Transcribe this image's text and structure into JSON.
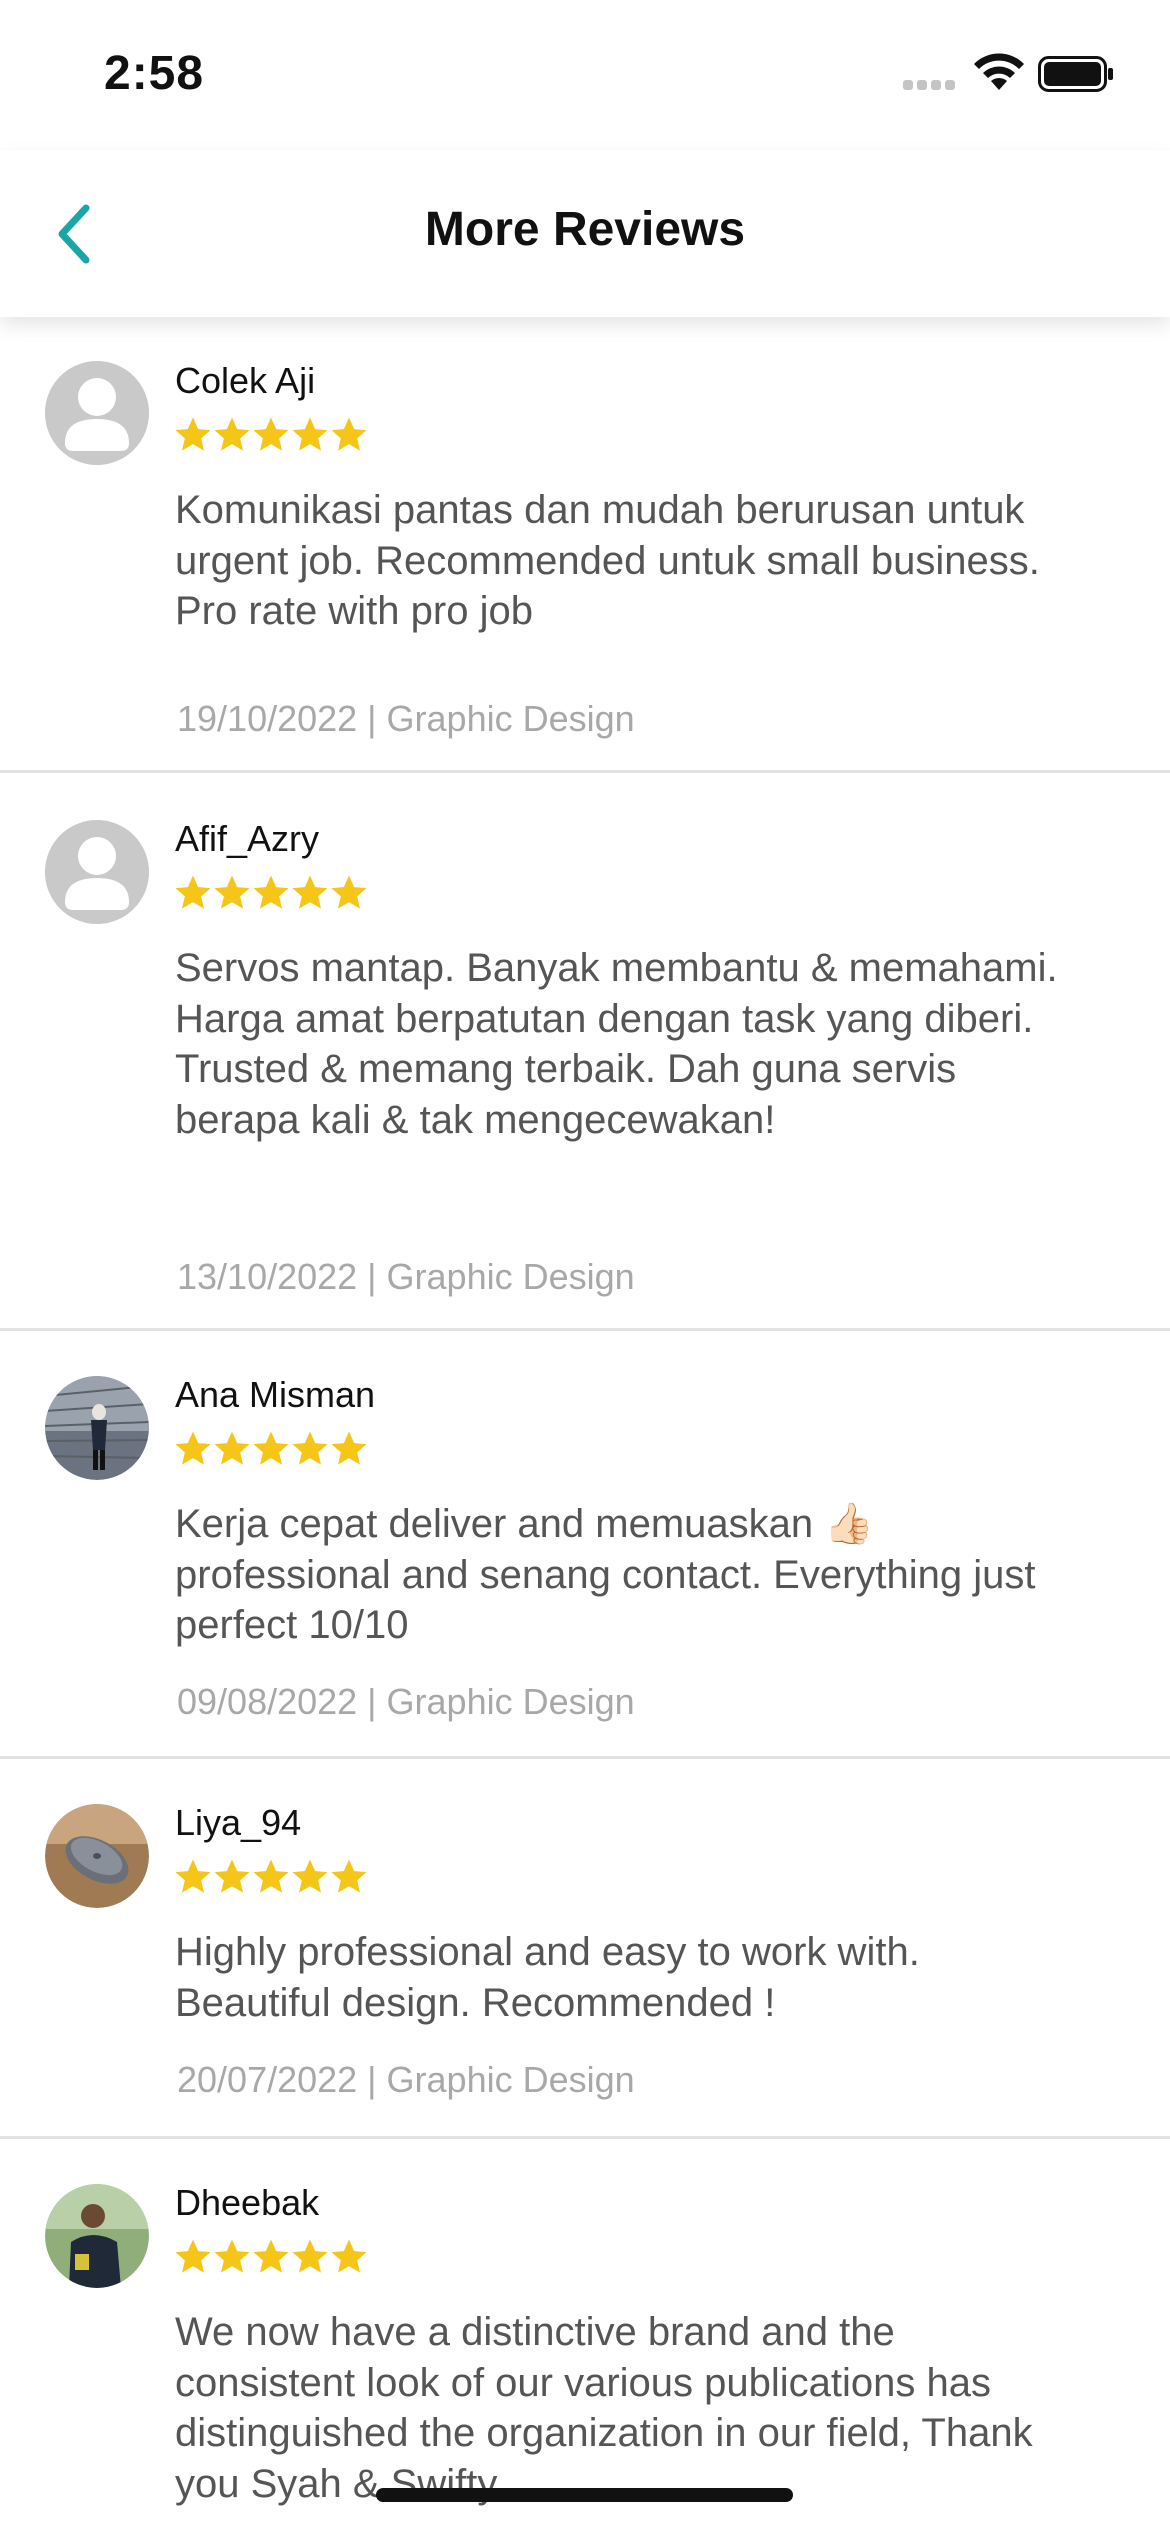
{
  "status_bar": {
    "time": "2:58"
  },
  "nav": {
    "title": "More Reviews"
  },
  "colors": {
    "accent": "#1aa6a6",
    "star": "#f5c518"
  },
  "reviews": [
    {
      "name": "Colek Aji",
      "rating": 5,
      "avatar": "placeholder",
      "text": "Komunikasi pantas dan mudah berurusan untuk urgent job. Recommended untuk small business. Pro rate with pro job",
      "meta": "19/10/2022 | Graphic Design"
    },
    {
      "name": "Afif_Azry",
      "rating": 5,
      "avatar": "placeholder",
      "text": "Servos mantap. Banyak membantu & memahami. Harga amat berpatutan dengan task yang diberi. Trusted & memang terbaik. Dah guna servis berapa kali & tak mengecewakan!",
      "meta": "13/10/2022 | Graphic Design"
    },
    {
      "name": "Ana Misman",
      "rating": 5,
      "avatar": "photo",
      "text": "Kerja cepat deliver and memuaskan 👍🏻 professional and senang contact. Everything just perfect 10/10",
      "meta": "09/08/2022 | Graphic Design"
    },
    {
      "name": "Liya_94",
      "rating": 5,
      "avatar": "photo",
      "text": "Highly professional and easy to work with. Beautiful design. Recommended !",
      "meta": "20/07/2022 | Graphic Design"
    },
    {
      "name": "Dheebak",
      "rating": 5,
      "avatar": "photo",
      "text": "We now have a distinctive brand and the consistent look of our various publications has distinguished the organization in our field, Thank you Syah & Swifty",
      "meta": ""
    }
  ]
}
